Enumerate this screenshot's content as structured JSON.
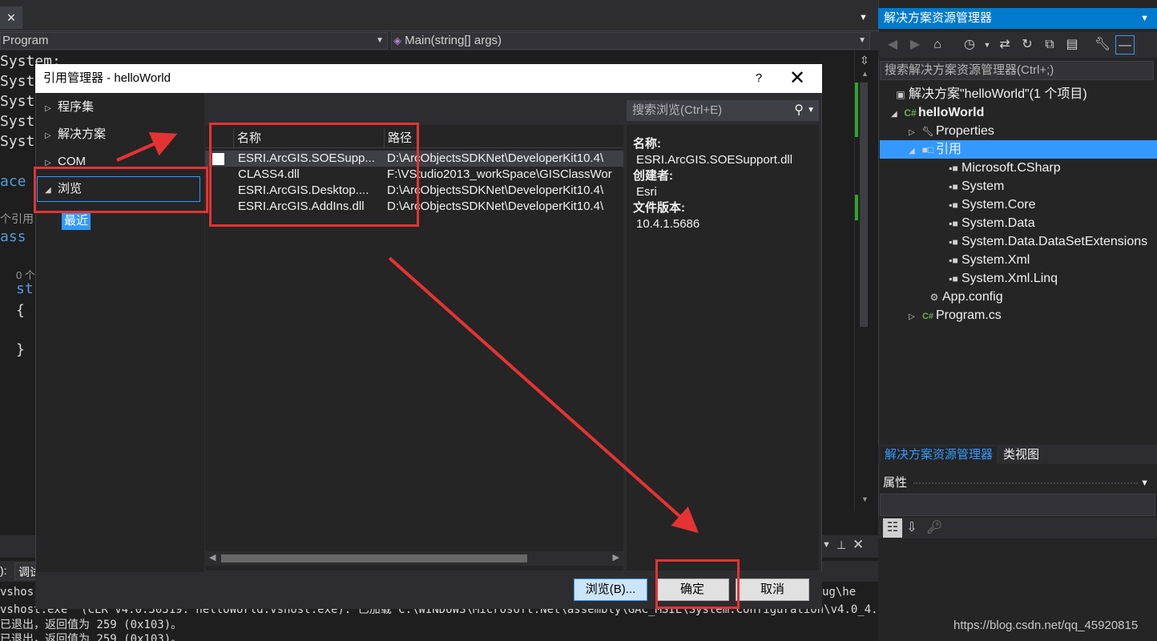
{
  "editor": {
    "tab_close": "×",
    "nav_left": "Program",
    "nav_right": "Main(string[] args)",
    "code_lines": [
      "System;",
      "Syst",
      "Syst",
      "Syst",
      "Syst"
    ],
    "keyword_ace": "ace",
    "ref_hint": "个引用",
    "keyword_ass": "ass",
    "ref_count": "0 个",
    "keyword_st": "st",
    "brace_open": "{",
    "brace_close": "}"
  },
  "output": {
    "label": "):",
    "combo": "调试",
    "lines": [
      "vshos",
      "vshost.exe\" (CLR v4.0.30319: helloWorld.vshost.exe): 已加载\"C:\\WINDOWS\\Microsoft.Net\\assembly\\GAC_MSIL\\System.Configuration\\v4.0_4.",
      "已退出，返回值为 259 (0x103)。",
      "已退出，返回值为 259 (0x103)。"
    ],
    "right_text": "ug\\he"
  },
  "solution_explorer": {
    "title": "解决方案资源管理器",
    "search_placeholder": "搜索解决方案资源管理器(Ctrl+;)",
    "solution": "解决方案\"helloWorld\"(1 个项目)",
    "project": "helloWorld",
    "properties": "Properties",
    "references": "引用",
    "refs": [
      "Microsoft.CSharp",
      "System",
      "System.Core",
      "System.Data",
      "System.Data.DataSetExtensions",
      "System.Xml",
      "System.Xml.Linq"
    ],
    "app_config": "App.config",
    "program_cs": "Program.cs",
    "tab_active": "解决方案资源管理器",
    "tab_class": "类视图"
  },
  "properties": {
    "title": "属性"
  },
  "dialog": {
    "title": "引用管理器 - helloWorld",
    "help": "?",
    "close": "✕",
    "categories": [
      "程序集",
      "解决方案",
      "COM",
      "浏览"
    ],
    "recent": "最近",
    "search_placeholder": "搜索浏览(Ctrl+E)",
    "columns": {
      "name": "名称",
      "path": "路径"
    },
    "rows": [
      {
        "name": "ESRI.ArcGIS.SOESupp...",
        "path": "D:\\ArcObjectsSDKNet\\DeveloperKit10.4\\"
      },
      {
        "name": "CLASS4.dll",
        "path": "F:\\VStudio2013_workSpace\\GISClassWor"
      },
      {
        "name": "ESRI.ArcGIS.Desktop....",
        "path": "D:\\ArcObjectsSDKNet\\DeveloperKit10.4\\"
      },
      {
        "name": "ESRI.ArcGIS.AddIns.dll",
        "path": "D:\\ArcObjectsSDKNet\\DeveloperKit10.4\\"
      }
    ],
    "detail": {
      "name_label": "名称:",
      "name_value": "ESRI.ArcGIS.SOESupport.dll",
      "creator_label": "创建者:",
      "creator_value": "Esri",
      "version_label": "文件版本:",
      "version_value": "10.4.1.5686"
    },
    "buttons": {
      "browse": "浏览(B)...",
      "ok": "确定",
      "cancel": "取消"
    }
  },
  "watermark": "https://blog.csdn.net/qq_45920815",
  "colors": {
    "accent": "#007acc",
    "selection": "#3399ff",
    "annotation": "#e53333"
  }
}
